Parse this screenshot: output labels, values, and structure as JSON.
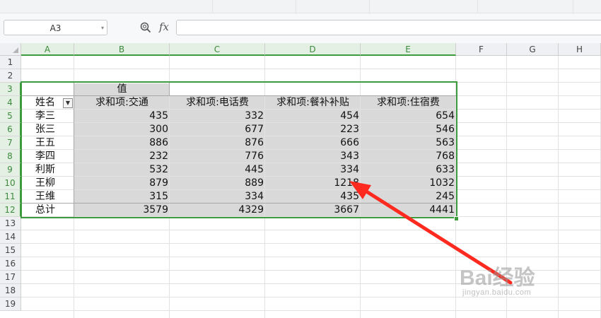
{
  "name_box": {
    "value": "A3"
  },
  "formula_bar": {
    "fx_label": "fx",
    "value": ""
  },
  "columns": [
    "A",
    "B",
    "C",
    "D",
    "E",
    "F",
    "G",
    "H"
  ],
  "rows": [
    "1",
    "2",
    "3",
    "4",
    "5",
    "6",
    "7",
    "8",
    "9",
    "10",
    "11",
    "12",
    "13",
    "14",
    "15",
    "16",
    "17",
    "18",
    "19"
  ],
  "pivot": {
    "values_header": "值",
    "name_header": "姓名",
    "headers": [
      "求和项:交通",
      "求和项:电话费",
      "求和项:餐补补贴",
      "求和项:住宿费"
    ],
    "rows": [
      {
        "name": "李三",
        "values": [
          "435",
          "332",
          "454",
          "654"
        ]
      },
      {
        "name": "张三",
        "values": [
          "300",
          "677",
          "223",
          "546"
        ]
      },
      {
        "name": "王五",
        "values": [
          "886",
          "876",
          "666",
          "563"
        ]
      },
      {
        "name": "李四",
        "values": [
          "232",
          "776",
          "343",
          "768"
        ]
      },
      {
        "name": "利斯",
        "values": [
          "532",
          "445",
          "334",
          "633"
        ]
      },
      {
        "name": "王柳",
        "values": [
          "879",
          "889",
          "1218",
          "1032"
        ]
      },
      {
        "name": "王维",
        "values": [
          "315",
          "334",
          "435",
          "245"
        ]
      }
    ],
    "total": {
      "name": "总计",
      "values": [
        "3579",
        "4329",
        "3667",
        "4441"
      ]
    }
  },
  "watermark": {
    "brand": "Bai经验",
    "url": "jingyan.baidu.com"
  },
  "colors": {
    "selection": "#3d9a3d",
    "pivot_fill": "#d9d9d9",
    "arrow": "#ff2a1f"
  }
}
